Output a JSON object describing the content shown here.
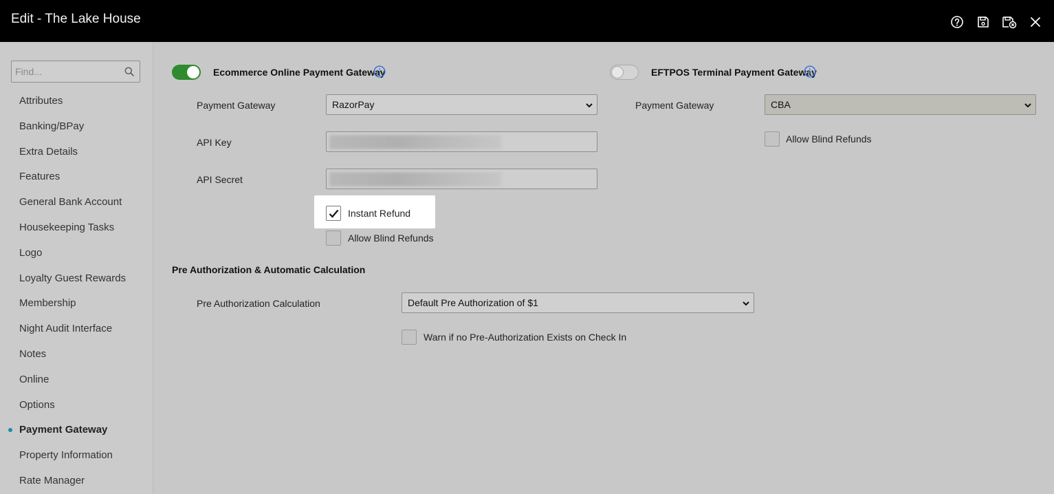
{
  "window": {
    "title": "Edit - The Lake House"
  },
  "toolbar": {
    "icons": [
      "help-icon",
      "save-icon",
      "save-close-icon",
      "close-icon"
    ]
  },
  "sidebar": {
    "search_placeholder": "Find...",
    "items": [
      {
        "label": "Attributes"
      },
      {
        "label": "Banking/BPay"
      },
      {
        "label": "Extra Details"
      },
      {
        "label": "Features"
      },
      {
        "label": "General Bank Account"
      },
      {
        "label": "Housekeeping Tasks"
      },
      {
        "label": "Logo"
      },
      {
        "label": "Loyalty Guest Rewards"
      },
      {
        "label": "Membership"
      },
      {
        "label": "Night Audit Interface"
      },
      {
        "label": "Notes"
      },
      {
        "label": "Online"
      },
      {
        "label": "Options"
      },
      {
        "label": "Payment Gateway",
        "active": true
      },
      {
        "label": "Property Information"
      },
      {
        "label": "Rate Manager"
      }
    ]
  },
  "ecommerce": {
    "title": "Ecommerce Online Payment Gateway",
    "enabled": true,
    "payment_gateway_label": "Payment Gateway",
    "payment_gateway_value": "RazorPay",
    "api_key_label": "API Key",
    "api_secret_label": "API Secret",
    "instant_refund_label": "Instant Refund",
    "instant_refund_checked": true,
    "allow_blind_refunds_label": "Allow Blind Refunds",
    "allow_blind_refunds_checked": false
  },
  "eftpos": {
    "title": "EFTPOS Terminal Payment Gateway",
    "enabled": false,
    "payment_gateway_label": "Payment Gateway",
    "payment_gateway_value": "CBA",
    "allow_blind_refunds_label": "Allow Blind Refunds",
    "allow_blind_refunds_checked": false
  },
  "preauth": {
    "title": "Pre Authorization & Automatic Calculation",
    "calc_label": "Pre Authorization Calculation",
    "calc_value": "Default Pre Authorization of $1",
    "warn_label": "Warn if no Pre-Authorization Exists on Check In",
    "warn_checked": false
  },
  "colors": {
    "accent": "#2e8b2e",
    "info": "#2f6fd6",
    "active_dot": "#1a8fa0"
  }
}
